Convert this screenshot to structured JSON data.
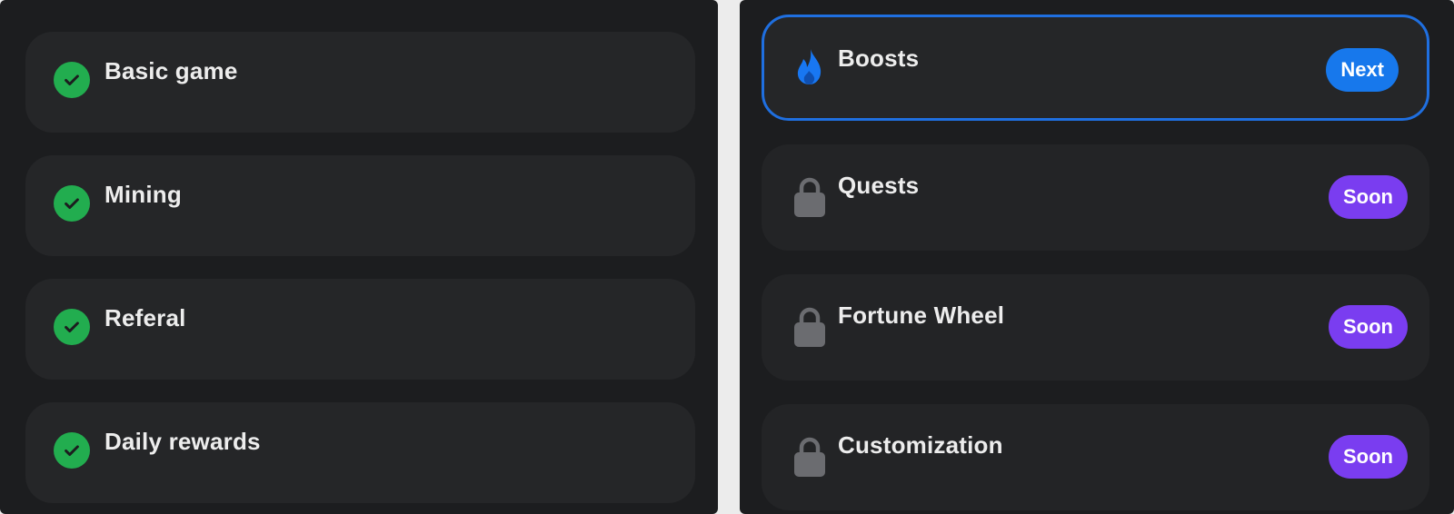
{
  "completed": {
    "items": [
      {
        "label": "Basic game",
        "icon": "check-circle-icon"
      },
      {
        "label": "Mining",
        "icon": "check-circle-icon"
      },
      {
        "label": "Referal",
        "icon": "check-circle-icon"
      },
      {
        "label": "Daily rewards",
        "icon": "check-circle-icon"
      }
    ]
  },
  "upcoming": {
    "items": [
      {
        "label": "Boosts",
        "icon": "flame-icon",
        "badge": "Next",
        "state": "active"
      },
      {
        "label": "Quests",
        "icon": "lock-icon",
        "badge": "Soon",
        "state": "locked"
      },
      {
        "label": "Fortune Wheel",
        "icon": "lock-icon",
        "badge": "Soon",
        "state": "locked"
      },
      {
        "label": "Customization",
        "icon": "lock-icon",
        "badge": "Soon",
        "state": "locked"
      }
    ]
  },
  "colors": {
    "check": "#22ad4f",
    "next_badge": "#1778ec",
    "soon_badge": "#7a3df0",
    "active_border": "#1f6fe0",
    "lock": "#6b6c70"
  }
}
